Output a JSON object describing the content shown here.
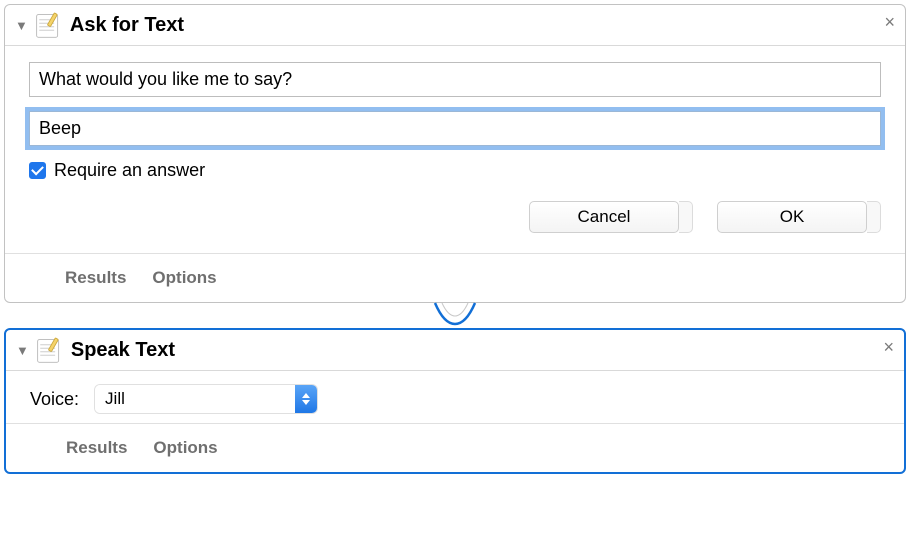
{
  "actions": {
    "ask_for_text": {
      "title": "Ask for Text",
      "icon": "textedit-icon",
      "question_value": "What would you like me to say?",
      "default_answer_value": "Beep",
      "require_answer_checked": true,
      "require_answer_label": "Require an answer",
      "buttons": {
        "cancel": "Cancel",
        "ok": "OK"
      },
      "footer": {
        "results": "Results",
        "options": "Options"
      }
    },
    "speak_text": {
      "title": "Speak Text",
      "icon": "textedit-icon",
      "voice_label": "Voice:",
      "voice_selected": "Jill",
      "footer": {
        "results": "Results",
        "options": "Options"
      }
    }
  }
}
